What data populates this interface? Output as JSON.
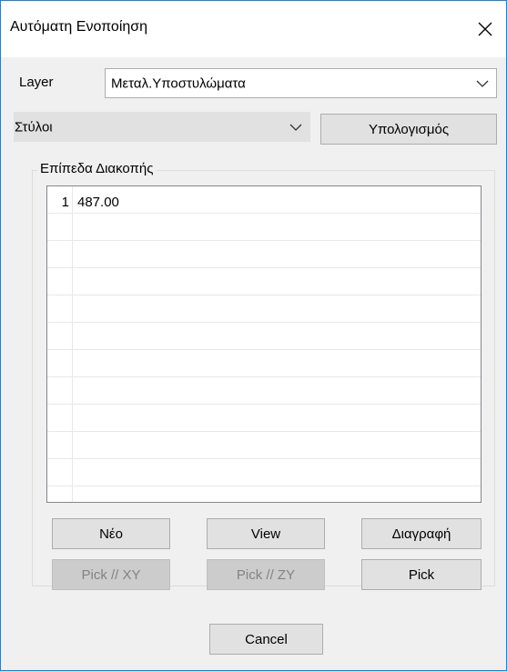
{
  "window": {
    "title": "Αυτόματη Ενοποίηση",
    "close_icon": "close-icon"
  },
  "layer": {
    "label": "Layer",
    "value": "Μεταλ.Υποστυλώματα"
  },
  "type_select": {
    "value": "Στύλοι"
  },
  "calc_button": "Υπολογισμός",
  "group": {
    "legend": "Επίπεδα Διακοπής",
    "rows": [
      {
        "index": "1",
        "value": "487.00"
      },
      {
        "index": "",
        "value": ""
      },
      {
        "index": "",
        "value": ""
      },
      {
        "index": "",
        "value": ""
      },
      {
        "index": "",
        "value": ""
      },
      {
        "index": "",
        "value": ""
      },
      {
        "index": "",
        "value": ""
      },
      {
        "index": "",
        "value": ""
      },
      {
        "index": "",
        "value": ""
      },
      {
        "index": "",
        "value": ""
      },
      {
        "index": "",
        "value": ""
      },
      {
        "index": "",
        "value": ""
      }
    ],
    "buttons": {
      "new": "Νέο",
      "view": "View",
      "delete": "Διαγραφή",
      "pick_xy": "Pick // XY",
      "pick_zy": "Pick // ZY",
      "pick": "Pick"
    }
  },
  "cancel_button": "Cancel",
  "colors": {
    "window_border": "#1883d7",
    "dialog_bg": "#f0f0f0",
    "button_bg": "#e1e1e1",
    "disabled_bg": "#cccccc"
  }
}
